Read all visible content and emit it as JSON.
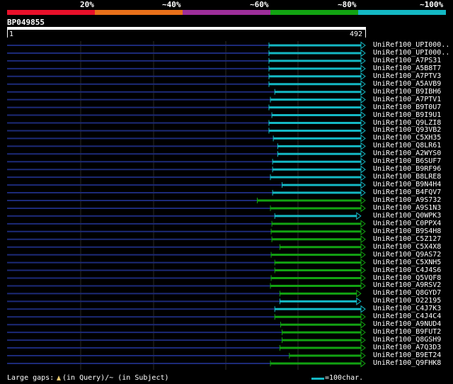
{
  "identity_legend": {
    "labels": [
      "20%",
      "~40%",
      "~60%",
      "~80%",
      "~100%"
    ],
    "colors": [
      "#e8102a",
      "#e8701a",
      "#9d2e9a",
      "#12a312",
      "#14b8c4"
    ]
  },
  "query": {
    "id": "BP049855",
    "start_label": "1",
    "end_label": "492"
  },
  "footer": {
    "large_gaps_text": "Large gaps: ",
    "in_query_text": "(in Query)/~ (in Subject)",
    "scale_text": "=100char."
  },
  "chart_data": {
    "type": "alignment-overview",
    "query_length": 492,
    "hits": [
      {
        "label": "UniRef100_UPI000..",
        "start": 360,
        "end": 492,
        "color": "#14b8c4"
      },
      {
        "label": "UniRef100_UPI000..",
        "start": 360,
        "end": 492,
        "color": "#14b8c4"
      },
      {
        "label": "UniRef100_A7PS31",
        "start": 360,
        "end": 492,
        "color": "#14b8c4"
      },
      {
        "label": "UniRef100_A5B8T7",
        "start": 360,
        "end": 492,
        "color": "#14b8c4"
      },
      {
        "label": "UniRef100_A7PTV3",
        "start": 360,
        "end": 492,
        "color": "#14b8c4"
      },
      {
        "label": "UniRef100_A5AVB9",
        "start": 360,
        "end": 492,
        "color": "#14b8c4"
      },
      {
        "label": "UniRef100_B9IBH6",
        "start": 368,
        "end": 492,
        "color": "#14b8c4"
      },
      {
        "label": "UniRef100_A7PTV1",
        "start": 362,
        "end": 492,
        "color": "#14b8c4"
      },
      {
        "label": "UniRef100_B9T0U7",
        "start": 360,
        "end": 492,
        "color": "#14b8c4"
      },
      {
        "label": "UniRef100_B9I9U1",
        "start": 364,
        "end": 492,
        "color": "#14b8c4"
      },
      {
        "label": "UniRef100_Q9LZI8",
        "start": 360,
        "end": 492,
        "color": "#14b8c4"
      },
      {
        "label": "UniRef100_Q93VB2",
        "start": 360,
        "end": 492,
        "color": "#14b8c4"
      },
      {
        "label": "UniRef100_C5XH35",
        "start": 366,
        "end": 492,
        "color": "#14b8c4"
      },
      {
        "label": "UniRef100_Q8LR61",
        "start": 372,
        "end": 492,
        "color": "#14b8c4"
      },
      {
        "label": "UniRef100_A2WYS0",
        "start": 372,
        "end": 492,
        "color": "#14b8c4"
      },
      {
        "label": "UniRef100_B6SUF7",
        "start": 365,
        "end": 492,
        "color": "#14b8c4"
      },
      {
        "label": "UniRef100_B9RF96",
        "start": 365,
        "end": 492,
        "color": "#14b8c4"
      },
      {
        "label": "UniRef100_B8LRE8",
        "start": 362,
        "end": 492,
        "color": "#14b8c4"
      },
      {
        "label": "UniRef100_B9N4H4",
        "start": 378,
        "end": 492,
        "color": "#14b8c4"
      },
      {
        "label": "UniRef100_B4FQV7",
        "start": 365,
        "end": 492,
        "color": "#14b8c4"
      },
      {
        "label": "UniRef100_A9S732",
        "start": 344,
        "end": 492,
        "color": "#12a312"
      },
      {
        "label": "UniRef100_A9S1N3",
        "start": 362,
        "end": 492,
        "color": "#12a312"
      },
      {
        "label": "UniRef100_Q0WPK3",
        "start": 368,
        "end": 486,
        "color": "#14b8c4"
      },
      {
        "label": "UniRef100_C0PPX4",
        "start": 364,
        "end": 492,
        "color": "#12a312"
      },
      {
        "label": "UniRef100_B9S4H8",
        "start": 363,
        "end": 492,
        "color": "#12a312"
      },
      {
        "label": "UniRef100_C5Z127",
        "start": 364,
        "end": 492,
        "color": "#12a312"
      },
      {
        "label": "UniRef100_C5X4X8",
        "start": 375,
        "end": 492,
        "color": "#12a312"
      },
      {
        "label": "UniRef100_Q9AS72",
        "start": 363,
        "end": 492,
        "color": "#12a312"
      },
      {
        "label": "UniRef100_C5XNH5",
        "start": 368,
        "end": 492,
        "color": "#12a312"
      },
      {
        "label": "UniRef100_C4J4S6",
        "start": 368,
        "end": 492,
        "color": "#12a312"
      },
      {
        "label": "UniRef100_Q5VQF8",
        "start": 363,
        "end": 492,
        "color": "#12a312"
      },
      {
        "label": "UniRef100_A9RSV2",
        "start": 362,
        "end": 492,
        "color": "#12a312"
      },
      {
        "label": "UniRef100_Q8GYD7",
        "start": 375,
        "end": 486,
        "color": "#12a312"
      },
      {
        "label": "UniRef100_O22195",
        "start": 375,
        "end": 486,
        "color": "#14b8c4"
      },
      {
        "label": "UniRef100_C4J7K3",
        "start": 368,
        "end": 492,
        "color": "#14b8c4"
      },
      {
        "label": "UniRef100_C4J4C4",
        "start": 368,
        "end": 492,
        "color": "#12a312"
      },
      {
        "label": "UniRef100_A9NUD4",
        "start": 376,
        "end": 492,
        "color": "#12a312"
      },
      {
        "label": "UniRef100_B9FUT2",
        "start": 378,
        "end": 492,
        "color": "#12a312"
      },
      {
        "label": "UniRef100_Q8GSH9",
        "start": 378,
        "end": 492,
        "color": "#12a312"
      },
      {
        "label": "UniRef100_A7Q3D3",
        "start": 375,
        "end": 492,
        "color": "#12a312"
      },
      {
        "label": "UniRef100_B9ET24",
        "start": 388,
        "end": 492,
        "color": "#12a312"
      },
      {
        "label": "UniRef100_Q9FHK8",
        "start": 362,
        "end": 492,
        "color": "#12a312"
      }
    ]
  }
}
